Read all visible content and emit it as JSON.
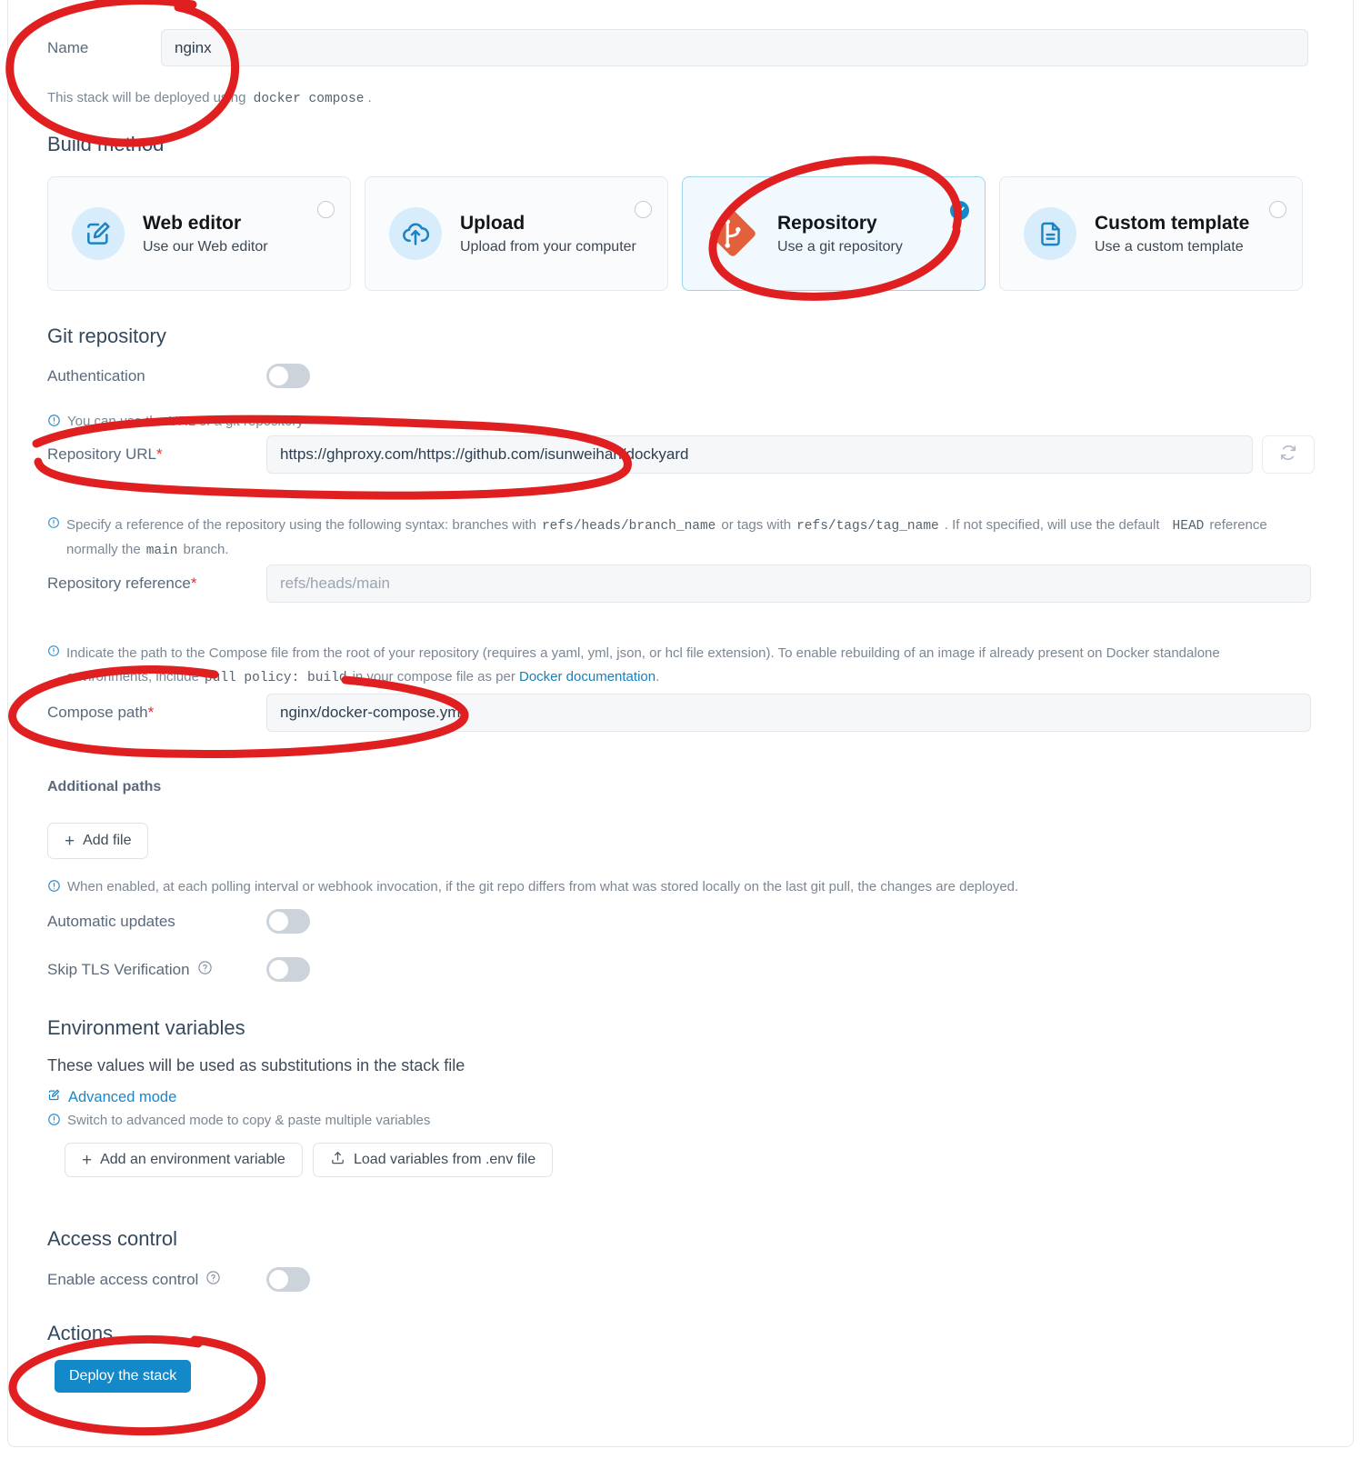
{
  "name_field": {
    "label": "Name",
    "value": "nginx",
    "helper_prefix": "This stack will be deployed using",
    "helper_code": "docker compose",
    "helper_suffix": "."
  },
  "build_method": {
    "title": "Build method",
    "options": [
      {
        "title": "Web editor",
        "desc": "Use our Web editor",
        "icon": "web-editor-icon",
        "selected": false
      },
      {
        "title": "Upload",
        "desc": "Upload from your computer",
        "icon": "upload-cloud-icon",
        "selected": false
      },
      {
        "title": "Repository",
        "desc": "Use a git repository",
        "icon": "git-repository-icon",
        "selected": true
      },
      {
        "title": "Custom template",
        "desc": "Use a custom template",
        "icon": "document-icon",
        "selected": false
      }
    ]
  },
  "git_repository": {
    "title": "Git repository",
    "authentication_label": "Authentication",
    "authentication_on": false,
    "url_hint": "You can use the URL of a git repository",
    "url_label": "Repository URL",
    "url_value": "https://ghproxy.com/https://github.com/isunweihan/dockyard",
    "refresh_icon": "refresh-icon",
    "reference_hint_1": "Specify a reference of the repository using the following syntax: branches with",
    "reference_code_1": "refs/heads/branch_name",
    "reference_hint_2": "or tags with",
    "reference_code_2": "refs/tags/tag_name",
    "reference_hint_3": ". If not specified, will use the default",
    "reference_code_3": "HEAD",
    "reference_hint_4": "reference normally the",
    "reference_code_4": "main",
    "reference_hint_5": "branch.",
    "reference_label": "Repository reference",
    "reference_placeholder": "refs/heads/main",
    "compose_hint_1": "Indicate the path to the Compose file from the root of your repository (requires a yaml, yml, json, or hcl file extension).  To enable rebuilding of an image if already present on Docker standalone environments, include",
    "compose_code": "pull policy: build",
    "compose_hint_2": "in your compose file as per",
    "compose_link": "Docker documentation",
    "compose_hint_3": ".",
    "compose_label": "Compose path",
    "compose_value": "nginx/docker-compose.yml",
    "additional_paths_title": "Additional paths",
    "add_file_label": "Add file",
    "auto_update_hint": "When enabled, at each polling interval or webhook invocation, if the git repo differs from what was stored locally on the last git pull, the changes are deployed.",
    "automatic_updates_label": "Automatic updates",
    "automatic_updates_on": false,
    "skip_tls_label": "Skip TLS Verification",
    "skip_tls_on": false,
    "help_icon": "question-mark-icon"
  },
  "environment_variables": {
    "title": "Environment variables",
    "description": "These values will be used as substitutions in the stack file",
    "advanced_mode_label": "Advanced mode",
    "advanced_mode_icon": "edit-icon",
    "advanced_hint": "Switch to advanced mode to copy & paste multiple variables",
    "add_variable_label": "Add an environment variable",
    "load_env_label": "Load variables from .env file",
    "load_env_icon": "upload-icon"
  },
  "access_control": {
    "title": "Access control",
    "enable_label": "Enable access control",
    "enable_on": false,
    "help_icon": "question-mark-icon"
  },
  "actions": {
    "title": "Actions",
    "deploy_label": "Deploy the stack"
  },
  "colors": {
    "accent_blue": "#1389c9",
    "selected_card_bg": "#f1f9fe",
    "selected_card_border": "#9fd4ef",
    "git_orange": "#e2613c",
    "annotation_red": "#e02020",
    "required_red": "#e03131"
  },
  "annotations": [
    {
      "name": "name-field-circle"
    },
    {
      "name": "repository-card-circle"
    },
    {
      "name": "repository-url-circle"
    },
    {
      "name": "compose-path-circle"
    },
    {
      "name": "deploy-button-circle"
    }
  ]
}
